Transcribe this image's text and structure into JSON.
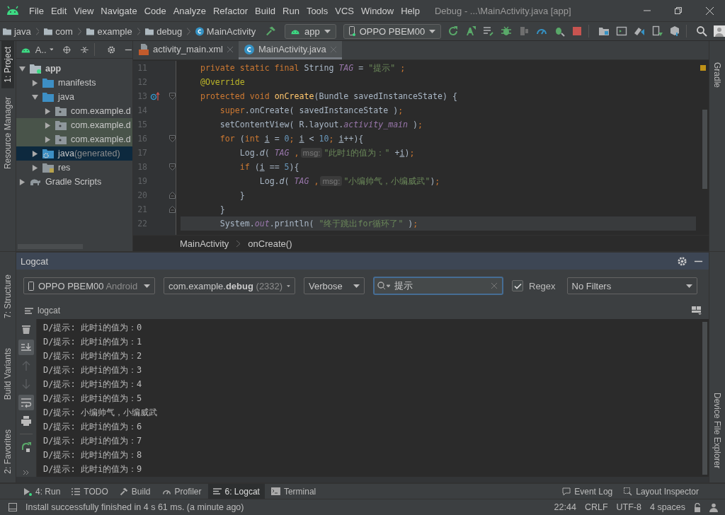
{
  "menu_bar": {
    "menus": [
      "File",
      "Edit",
      "View",
      "Navigate",
      "Code",
      "Analyze",
      "Refactor",
      "Build",
      "Run",
      "Tools",
      "VCS",
      "Window",
      "Help"
    ],
    "title": "Debug - ...\\MainActivity.java [app]"
  },
  "nav_bar": {
    "breadcrumbs": [
      {
        "label": "java",
        "kind": "folder"
      },
      {
        "label": "com",
        "kind": "folder"
      },
      {
        "label": "example",
        "kind": "folder"
      },
      {
        "label": "debug",
        "kind": "folder"
      },
      {
        "label": "MainActivity",
        "kind": "class"
      }
    ],
    "run_config": "app",
    "device": "OPPO PBEM00"
  },
  "left_stripe": {
    "top": [
      {
        "label": "1: Project",
        "selected": true
      },
      {
        "label": "Resource Manager",
        "selected": false
      }
    ],
    "bottom": [
      {
        "label": "7: Structure",
        "selected": false
      },
      {
        "label": "Build Variants",
        "selected": false
      },
      {
        "label": "2: Favorites",
        "selected": false
      }
    ]
  },
  "right_stripe": {
    "top": "Gradle",
    "bottom": "Device File Explorer"
  },
  "project": {
    "view": "A..",
    "tree": [
      {
        "label": "app",
        "kind": "module",
        "expanded": true,
        "selected": false,
        "children": [
          {
            "label": "manifests",
            "kind": "folder",
            "expanded": false,
            "selected": false
          },
          {
            "label": "java",
            "kind": "folder",
            "expanded": true,
            "selected": false,
            "children": [
              {
                "label": "com.example.d",
                "kind": "package",
                "expanded": false,
                "selected": false
              },
              {
                "label": "com.example.d",
                "kind": "test-package",
                "expanded": false,
                "selected": false
              },
              {
                "label": "com.example.d",
                "kind": "test-package",
                "expanded": false,
                "selected": false
              }
            ]
          },
          {
            "label": "java",
            "note": "(generated)",
            "kind": "generated",
            "expanded": false,
            "selected": true
          },
          {
            "label": "res",
            "kind": "res",
            "expanded": false,
            "selected": false
          }
        ]
      },
      {
        "label": "Gradle Scripts",
        "kind": "gradle",
        "expanded": false,
        "selected": false
      }
    ]
  },
  "editor": {
    "tabs": [
      {
        "label": "activity_main.xml",
        "kind": "xml",
        "selected": false
      },
      {
        "label": "MainActivity.java",
        "kind": "class",
        "selected": true
      }
    ],
    "lines": [
      {
        "number": "11",
        "current": false,
        "kind": "plain",
        "tokens": [
          {
            "kind": "kw",
            "text": "    private static final "
          },
          {
            "kind": "plain",
            "text": "String "
          },
          {
            "kind": "const",
            "text": "TAG"
          },
          {
            "kind": "plain",
            "text": " = "
          },
          {
            "kind": "str",
            "text": "\"提示\""
          },
          {
            "kind": "kw",
            "text": " ;"
          }
        ]
      },
      {
        "number": "12",
        "current": false,
        "kind": "plain",
        "tokens": [
          {
            "kind": "ann",
            "text": "    @Override"
          }
        ]
      },
      {
        "number": "13",
        "current": false,
        "kind": "override",
        "tokens": [
          {
            "kind": "kw",
            "text": "    protected void "
          },
          {
            "kind": "method",
            "text": "onCreate"
          },
          {
            "kind": "plain",
            "text": "(Bundle savedInstanceState) {"
          }
        ]
      },
      {
        "number": "14",
        "current": false,
        "kind": "plain",
        "tokens": [
          {
            "kind": "kw",
            "text": "        super"
          },
          {
            "kind": "plain",
            "text": ".onCreate( savedInstanceState )"
          },
          {
            "kind": "kw",
            "text": ";"
          }
        ]
      },
      {
        "number": "15",
        "current": false,
        "kind": "plain",
        "tokens": [
          {
            "kind": "plain",
            "text": "        setContentView( R.layout."
          },
          {
            "kind": "const",
            "text": "activity_main"
          },
          {
            "kind": "plain",
            "text": " )"
          },
          {
            "kind": "kw",
            "text": ";"
          }
        ]
      },
      {
        "number": "16",
        "current": false,
        "kind": "fold-start",
        "tokens": [
          {
            "kind": "kw",
            "text": "        for "
          },
          {
            "kind": "plain",
            "text": "("
          },
          {
            "kind": "kw",
            "text": "int "
          },
          {
            "kind": "var",
            "text": "i"
          },
          {
            "kind": "plain",
            "text": " = "
          },
          {
            "kind": "num",
            "text": "0"
          },
          {
            "kind": "kw",
            "text": "; "
          },
          {
            "kind": "var",
            "text": "i"
          },
          {
            "kind": "plain",
            "text": " < "
          },
          {
            "kind": "num",
            "text": "10"
          },
          {
            "kind": "kw",
            "text": "; "
          },
          {
            "kind": "var",
            "text": "i"
          },
          {
            "kind": "plain",
            "text": "++){"
          }
        ]
      },
      {
        "number": "17",
        "current": false,
        "kind": "plain",
        "tokens": [
          {
            "kind": "plain",
            "text": "            Log."
          },
          {
            "kind": "static",
            "text": "d"
          },
          {
            "kind": "plain",
            "text": "( "
          },
          {
            "kind": "const",
            "text": "TAG"
          },
          {
            "kind": "kw",
            "text": " ,"
          },
          {
            "kind": "hint",
            "text": "msg:"
          },
          {
            "kind": "str",
            "text": "\"此时i的值为：\""
          },
          {
            "kind": "plain",
            "text": " +"
          },
          {
            "kind": "var",
            "text": "i"
          },
          {
            "kind": "plain",
            "text": ")"
          },
          {
            "kind": "kw",
            "text": ";"
          }
        ]
      },
      {
        "number": "18",
        "current": false,
        "kind": "fold-start",
        "tokens": [
          {
            "kind": "kw",
            "text": "            if "
          },
          {
            "kind": "plain",
            "text": "("
          },
          {
            "kind": "var",
            "text": "i"
          },
          {
            "kind": "plain",
            "text": " == "
          },
          {
            "kind": "num",
            "text": "5"
          },
          {
            "kind": "plain",
            "text": "){"
          }
        ]
      },
      {
        "number": "19",
        "current": false,
        "kind": "plain",
        "tokens": [
          {
            "kind": "plain",
            "text": "                Log."
          },
          {
            "kind": "static",
            "text": "d"
          },
          {
            "kind": "plain",
            "text": "( "
          },
          {
            "kind": "const",
            "text": "TAG"
          },
          {
            "kind": "kw",
            "text": " ,"
          },
          {
            "kind": "hint",
            "text": "msg:"
          },
          {
            "kind": "str",
            "text": "\"小编帅气，小编威武\""
          },
          {
            "kind": "plain",
            "text": ")"
          },
          {
            "kind": "kw",
            "text": ";"
          }
        ]
      },
      {
        "number": "20",
        "current": false,
        "kind": "fold-end",
        "tokens": [
          {
            "kind": "plain",
            "text": "            }"
          }
        ]
      },
      {
        "number": "21",
        "current": false,
        "kind": "fold-end",
        "tokens": [
          {
            "kind": "plain",
            "text": "        }"
          }
        ]
      },
      {
        "number": "22",
        "current": true,
        "kind": "plain",
        "tokens": [
          {
            "kind": "plain",
            "text": "        System."
          },
          {
            "kind": "field",
            "text": "out"
          },
          {
            "kind": "plain",
            "text": ".println( "
          },
          {
            "kind": "str",
            "text": "\"终于跳出for循环了\""
          },
          {
            "kind": "plain",
            "text": " )"
          },
          {
            "kind": "kw",
            "text": ";"
          }
        ]
      }
    ],
    "breadcrumbs": [
      "MainActivity",
      "onCreate()"
    ]
  },
  "logcat": {
    "title": "Logcat",
    "device": {
      "name": "OPPO PBEM00",
      "platform": "Android"
    },
    "process": {
      "name": "com.example.**debug**",
      "pid": "(2332)"
    },
    "level": "Verbose",
    "search": "提示",
    "regex": {
      "label": "Regex",
      "checked": true
    },
    "filter": "No Filters",
    "tab": "logcat",
    "scroll_to_end": true,
    "soft_wrap": true,
    "lines": [
      "D/提示: 此时i的值为：0",
      "D/提示: 此时i的值为：1",
      "D/提示: 此时i的值为：2",
      "D/提示: 此时i的值为：3",
      "D/提示: 此时i的值为：4",
      "D/提示: 此时i的值为：5",
      "D/提示: 小编帅气，小编威武",
      "D/提示: 此时i的值为：6",
      "D/提示: 此时i的值为：7",
      "D/提示: 此时i的值为：8",
      "D/提示: 此时i的值为：9"
    ]
  },
  "tool_windows": {
    "left": [
      {
        "label": "4: Run",
        "kind": "run",
        "selected": false
      },
      {
        "label": "TODO",
        "kind": "todo",
        "selected": false
      },
      {
        "label": "Build",
        "kind": "build",
        "selected": false
      },
      {
        "label": "Profiler",
        "kind": "profiler",
        "selected": false
      },
      {
        "label": "6: Logcat",
        "kind": "logcat",
        "selected": true
      },
      {
        "label": "Terminal",
        "kind": "terminal",
        "selected": false
      }
    ],
    "right": [
      {
        "label": "Event Log",
        "kind": "event"
      },
      {
        "label": "Layout Inspector",
        "kind": "inspector"
      }
    ]
  },
  "status_bar": {
    "message": "Install successfully finished in 4 s 61 ms. (a minute ago)",
    "items": [
      "22:44",
      "CRLF",
      "UTF-8",
      "4 spaces"
    ]
  }
}
